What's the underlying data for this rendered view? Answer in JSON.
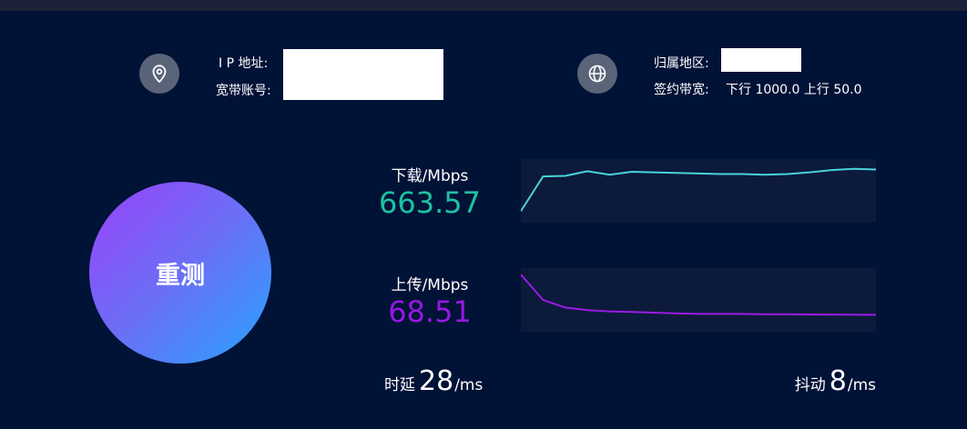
{
  "info": {
    "ip_label": "I P 地址:",
    "account_label": "宽带账号:",
    "region_label": "归属地区:",
    "bandwidth_label": "签约带宽:",
    "bandwidth_value": "下行 1000.0 上行 50.0"
  },
  "icons": {
    "location": "location-pin-icon",
    "globe": "globe-icon"
  },
  "retest": {
    "label": "重测"
  },
  "download": {
    "label": "下载/Mbps",
    "value": "663.57",
    "color": "#1cc2a0",
    "line_color": "#49d3d8"
  },
  "upload": {
    "label": "上传/Mbps",
    "value": "68.51",
    "color": "#9419e0",
    "line_color": "#9a1ae4"
  },
  "latency": {
    "label": "时延",
    "value": "28",
    "unit": "/ms"
  },
  "jitter": {
    "label": "抖动",
    "value": "8",
    "unit": "/ms"
  },
  "chart_data": [
    {
      "type": "line",
      "series": [
        {
          "values": [
            640,
            700,
            701,
            709,
            703,
            708,
            707,
            706,
            705,
            704,
            704,
            703,
            704,
            707,
            711,
            713,
            712
          ]
        }
      ],
      "ylim": [
        620,
        730
      ]
    },
    {
      "type": "line",
      "series": [
        {
          "values": [
            115,
            95,
            89,
            87,
            86,
            85.5,
            85,
            84.5,
            84,
            84,
            84,
            83.8,
            83.7,
            83.6,
            83.5,
            83.4,
            83.3
          ]
        }
      ],
      "ylim": [
        70,
        120
      ]
    }
  ]
}
